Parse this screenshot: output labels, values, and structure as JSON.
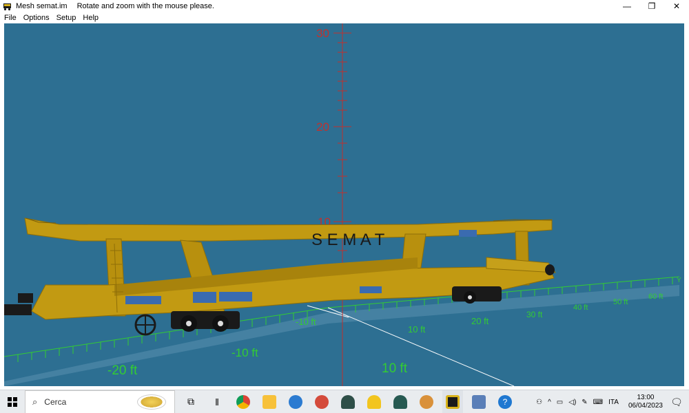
{
  "window": {
    "title": "Mesh semat.im",
    "hint": "Rotate and zoom with the mouse please.",
    "controls": {
      "minimize": "—",
      "restore": "❐",
      "close": "✕"
    }
  },
  "menu": {
    "items": [
      "File",
      "Options",
      "Setup",
      "Help"
    ]
  },
  "viewport": {
    "background": "#2d6f92",
    "vertical_axis": {
      "ticks": [
        "30",
        "20",
        "10"
      ]
    },
    "floor_grid": {
      "color": "#33cc33",
      "left_labels": [
        "-20 ft",
        "-10 ft"
      ],
      "right_labels": [
        "10 ft",
        "20 ft",
        "30 ft",
        "40 ft",
        "50 ft",
        "60 ft"
      ],
      "near_labels": [
        "-10 ft",
        "10 ft"
      ],
      "front_label": "10 ft",
      "axis_letter": "Y"
    },
    "wagon": {
      "body_color": "#b8900e",
      "brand_text": "S E M A T"
    }
  },
  "taskbar": {
    "search_placeholder": "Cerca",
    "tray": {
      "language": "ITA",
      "time": "13:00",
      "date": "06/04/2023"
    }
  }
}
